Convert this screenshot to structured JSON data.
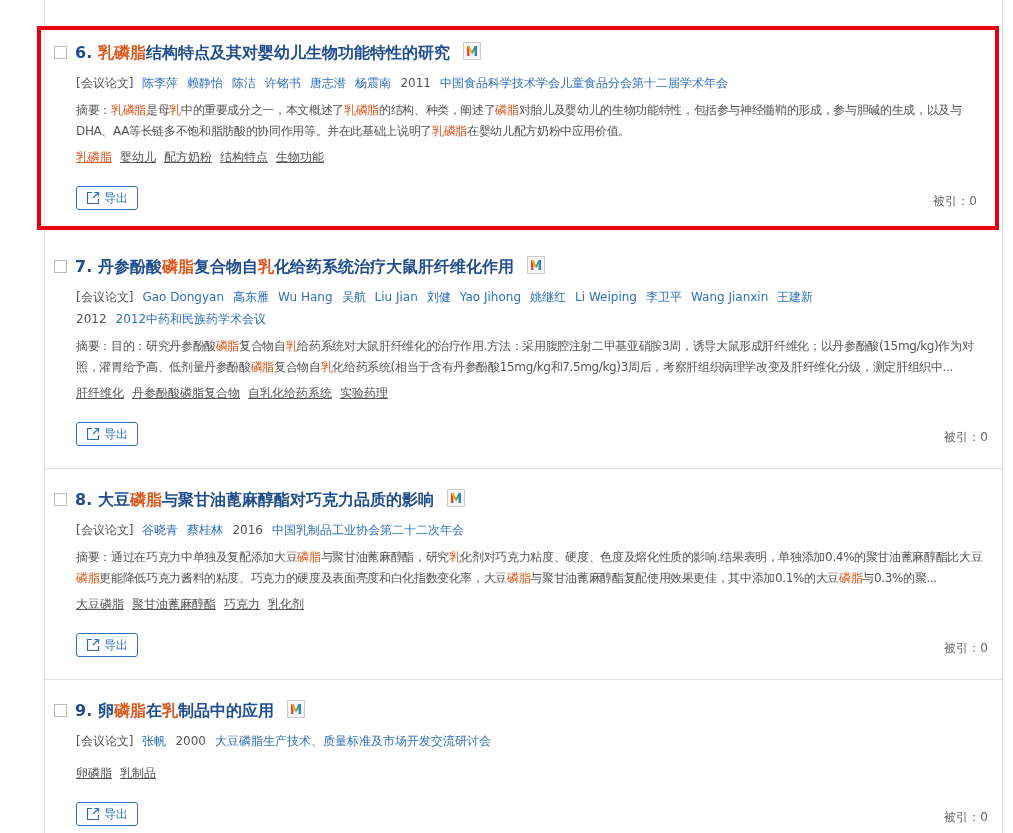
{
  "results": [
    {
      "number": "6.",
      "checked": false,
      "outlined": true,
      "title": [
        {
          "text": "乳磷脂",
          "hit": true
        },
        {
          "text": "结构特点及其对婴幼儿生物功能特性的研究",
          "hit": false
        }
      ],
      "type": "[会议论文]",
      "authors": [
        "陈李萍",
        "赖静怡",
        "陈洁",
        "许铭书",
        "唐志潜",
        "杨震南"
      ],
      "year": "2011",
      "source": "中国食品科学技术学会儿童食品分会第十二届学术年会",
      "abstract_label": "摘要：",
      "abstract": [
        {
          "text": "乳磷脂",
          "hit": true
        },
        {
          "text": "是母",
          "hit": false
        },
        {
          "text": "乳",
          "hit": true
        },
        {
          "text": "中的重要成分之一，本文概述了",
          "hit": false
        },
        {
          "text": "乳磷脂",
          "hit": true
        },
        {
          "text": "的结构、种类，阐述了",
          "hit": false
        },
        {
          "text": "磷脂",
          "hit": true
        },
        {
          "text": "对胎儿及婴幼儿的生物功能特性，包括参与神经髓鞘的形成，参与胆碱的生成，以及与DHA、AA等长链多不饱和脂肪酸的协同作用等。并在此基础上说明了",
          "hit": false
        },
        {
          "text": "乳磷脂",
          "hit": true
        },
        {
          "text": "在婴幼儿配方奶粉中应用价值。",
          "hit": false
        }
      ],
      "keywords": [
        {
          "text": "乳磷脂",
          "hit": true
        },
        {
          "text": "婴幼儿",
          "hit": false
        },
        {
          "text": "配方奶粉",
          "hit": false
        },
        {
          "text": "结构特点",
          "hit": false
        },
        {
          "text": "生物功能",
          "hit": false
        }
      ],
      "export": "导出",
      "cited": "被引：0"
    },
    {
      "number": "7.",
      "checked": false,
      "outlined": false,
      "title": [
        {
          "text": "丹参酚酸",
          "hit": false
        },
        {
          "text": "磷脂",
          "hit": true
        },
        {
          "text": "复合物自",
          "hit": false
        },
        {
          "text": "乳",
          "hit": true
        },
        {
          "text": "化给药系统治疗大鼠肝纤维化作用",
          "hit": false
        }
      ],
      "type": "[会议论文]",
      "authors": [
        "Gao Dongyan",
        "高东雁",
        "Wu Hang",
        "吴航",
        "Liu Jian",
        "刘健",
        "Yao Jihong",
        "姚继红",
        "Li Weiping",
        "李卫平",
        "Wang Jianxin",
        "王建新"
      ],
      "year": "2012",
      "source": "2012中药和民族药学术会议",
      "abstract_label": "摘要：",
      "abstract": [
        {
          "text": "目的：研究丹参酚酸",
          "hit": false
        },
        {
          "text": "磷脂",
          "hit": true
        },
        {
          "text": "复合物自",
          "hit": false
        },
        {
          "text": "乳",
          "hit": true
        },
        {
          "text": "给药系统对大鼠肝纤维化的治疗作用.方法：采用腹腔注射二甲基亚硝胺3周，诱导大鼠形成肝纤维化；以丹参酚酸(15mg/kg)作为对照，灌胃给予高、低剂量丹参酚酸",
          "hit": false
        },
        {
          "text": "磷脂",
          "hit": true
        },
        {
          "text": "复合物自",
          "hit": false
        },
        {
          "text": "乳",
          "hit": true
        },
        {
          "text": "化给药系统(相当于含有丹参酚酸15mg/kg和7.5mg/kg)3周后，考察肝组织病理学改变及肝纤维化分级，测定肝组织中...",
          "hit": false
        }
      ],
      "keywords": [
        {
          "text": "肝纤维化",
          "hit": false
        },
        {
          "text": "丹参酚酸磷脂复合物",
          "hit": false
        },
        {
          "text": "自乳化给药系统",
          "hit": false
        },
        {
          "text": "实验药理",
          "hit": false
        }
      ],
      "export": "导出",
      "cited": "被引：0"
    },
    {
      "number": "8.",
      "checked": false,
      "outlined": false,
      "title": [
        {
          "text": "大豆",
          "hit": false
        },
        {
          "text": "磷脂",
          "hit": true
        },
        {
          "text": "与聚甘油蓖麻醇酯对巧克力品质的影响",
          "hit": false
        }
      ],
      "type": "[会议论文]",
      "authors": [
        "谷晓青",
        "蔡桂林"
      ],
      "year": "2016",
      "source": "中国乳制品工业协会第二十二次年会",
      "abstract_label": "摘要：",
      "abstract": [
        {
          "text": "通过在巧克力中单独及复配添加大豆",
          "hit": false
        },
        {
          "text": "磷脂",
          "hit": true
        },
        {
          "text": "与聚甘油蓖麻醇酯，研究",
          "hit": false
        },
        {
          "text": "乳",
          "hit": true
        },
        {
          "text": "化剂对巧克力粘度、硬度、色度及熔化性质的影响.结果表明，单独添加0.4%的聚甘油蓖麻醇酯比大豆",
          "hit": false
        },
        {
          "text": "磷脂",
          "hit": true
        },
        {
          "text": "更能降低巧克力酱料的粘度、巧克力的硬度及表面亮度和白化指数变化率，大豆",
          "hit": false
        },
        {
          "text": "磷脂",
          "hit": true
        },
        {
          "text": "与聚甘油蓖麻醇酯复配使用效果更佳，其中添加0.1%的大豆",
          "hit": false
        },
        {
          "text": "磷脂",
          "hit": true
        },
        {
          "text": "与0.3%的聚...",
          "hit": false
        }
      ],
      "keywords": [
        {
          "text": "大豆磷脂",
          "hit": false
        },
        {
          "text": "聚甘油蓖麻醇酯",
          "hit": false
        },
        {
          "text": "巧克力",
          "hit": false
        },
        {
          "text": "乳化剂",
          "hit": false
        }
      ],
      "export": "导出",
      "cited": "被引：0"
    },
    {
      "number": "9.",
      "checked": false,
      "outlined": false,
      "title": [
        {
          "text": "卵",
          "hit": false
        },
        {
          "text": "磷脂",
          "hit": true
        },
        {
          "text": "在",
          "hit": false
        },
        {
          "text": "乳",
          "hit": true
        },
        {
          "text": "制品中的应用",
          "hit": false
        }
      ],
      "type": "[会议论文]",
      "authors": [
        "张帆"
      ],
      "year": "2000",
      "source": "大豆磷脂生产技术、质量标准及市场开发交流研讨会",
      "keywords": [
        {
          "text": "卵磷脂",
          "hit": false
        },
        {
          "text": "乳制品",
          "hit": false
        }
      ],
      "export": "导出",
      "cited": "被引：0"
    }
  ]
}
